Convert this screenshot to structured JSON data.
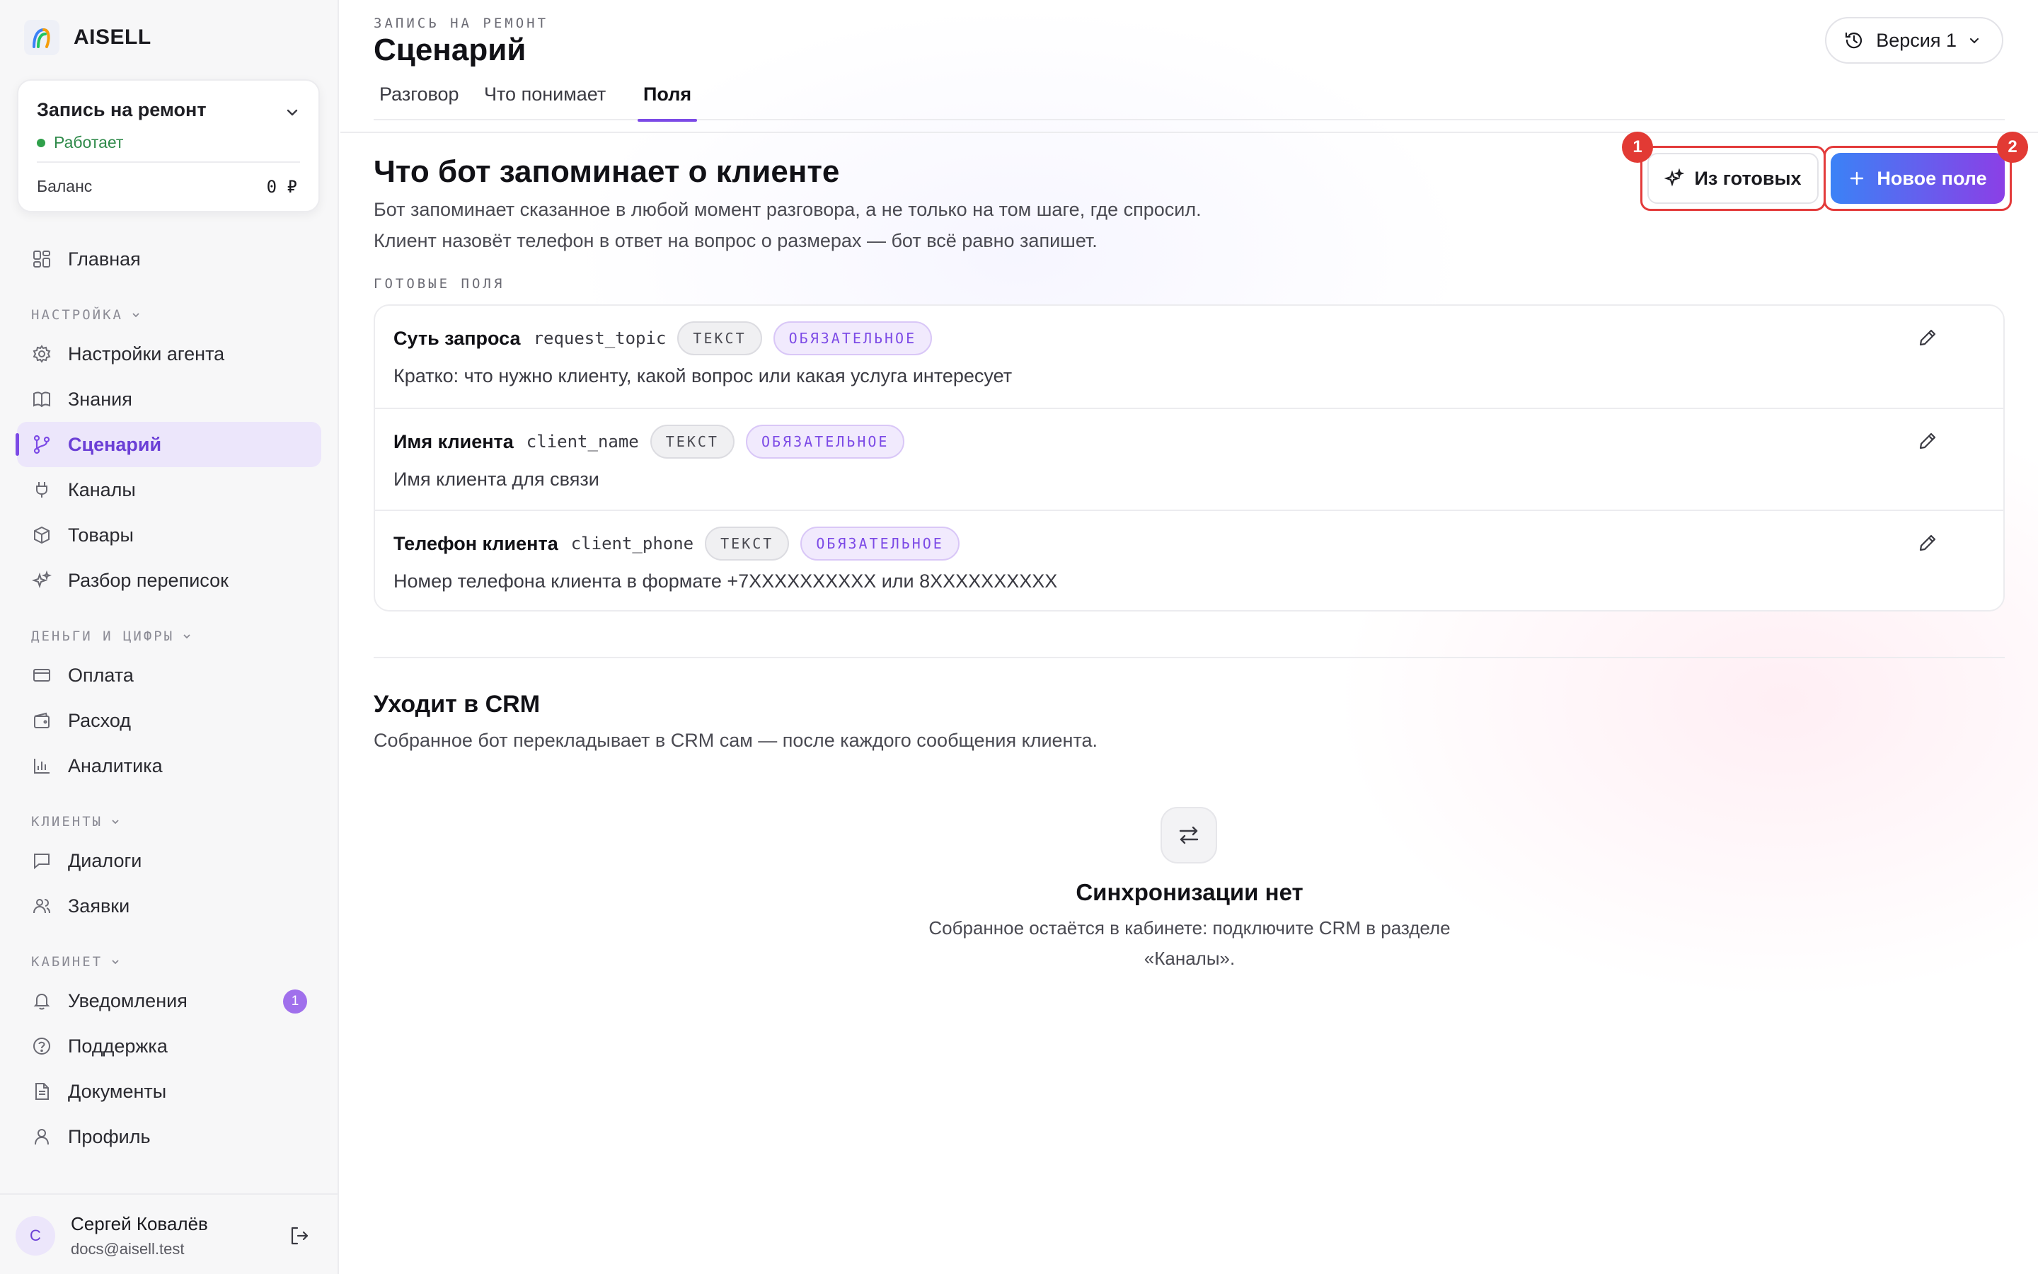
{
  "brand": {
    "name": "AISELL"
  },
  "project": {
    "title": "Запись на ремонт",
    "status": "Работает",
    "balance_label": "Баланс",
    "balance_value": "0 ₽"
  },
  "nav": {
    "home": "Главная",
    "section_settings": "НАСТРОЙКА",
    "agent_settings": "Настройки агента",
    "knowledge": "Знания",
    "scenario": "Сценарий",
    "channels": "Каналы",
    "products": "Товары",
    "analysis": "Разбор переписок",
    "section_money": "ДЕНЬГИ И ЦИФРЫ",
    "payment": "Оплата",
    "expense": "Расход",
    "analytics": "Аналитика",
    "section_clients": "КЛИЕНТЫ",
    "dialogs": "Диалоги",
    "requests": "Заявки",
    "section_cabinet": "КАБИНЕТ",
    "notifications": "Уведомления",
    "notifications_count": "1",
    "support": "Поддержка",
    "documents": "Документы",
    "profile": "Профиль"
  },
  "user": {
    "initial": "С",
    "name": "Сергей Ковалёв",
    "email": "docs@aisell.test"
  },
  "header": {
    "eyebrow": "ЗАПИСЬ НА РЕМОНТ",
    "title": "Сценарий",
    "version": "Версия 1",
    "tabs": [
      "Разговор",
      "Что понимает",
      "Поля"
    ]
  },
  "memory": {
    "title": "Что бот запоминает о клиенте",
    "desc_line1": "Бот запоминает сказанное в любой момент разговора, а не только на том шаге, где спросил.",
    "desc_line2": "Клиент назовёт телефон в ответ на вопрос о размерах — бот всё равно запишет.",
    "btn_ready": "Из готовых",
    "btn_new": "Новое поле",
    "marker1": "1",
    "marker2": "2",
    "ready_label": "ГОТОВЫЕ ПОЛЯ",
    "fields": [
      {
        "name": "Суть запроса",
        "key": "request_topic",
        "type": "ТЕКСТ",
        "required": "ОБЯЗАТЕЛЬНОЕ",
        "desc": "Кратко: что нужно клиенту, какой вопрос или какая услуга интересует"
      },
      {
        "name": "Имя клиента",
        "key": "client_name",
        "type": "ТЕКСТ",
        "required": "ОБЯЗАТЕЛЬНОЕ",
        "desc": "Имя клиента для связи"
      },
      {
        "name": "Телефон клиента",
        "key": "client_phone",
        "type": "ТЕКСТ",
        "required": "ОБЯЗАТЕЛЬНОЕ",
        "desc": "Номер телефона клиента в формате +7XXXXXXXXXX или 8XXXXXXXXXX"
      }
    ]
  },
  "crm": {
    "title": "Уходит в CRM",
    "desc": "Собранное бот перекладывает в CRM сам — после каждого сообщения клиента.",
    "empty_title": "Синхронизации нет",
    "empty_text": "Собранное остаётся в кабинете: подключите CRM в разделе «Каналы»."
  },
  "colors": {
    "accent": "#7c4ae6",
    "highlight": "#e23a34",
    "success": "#2fa04a"
  }
}
